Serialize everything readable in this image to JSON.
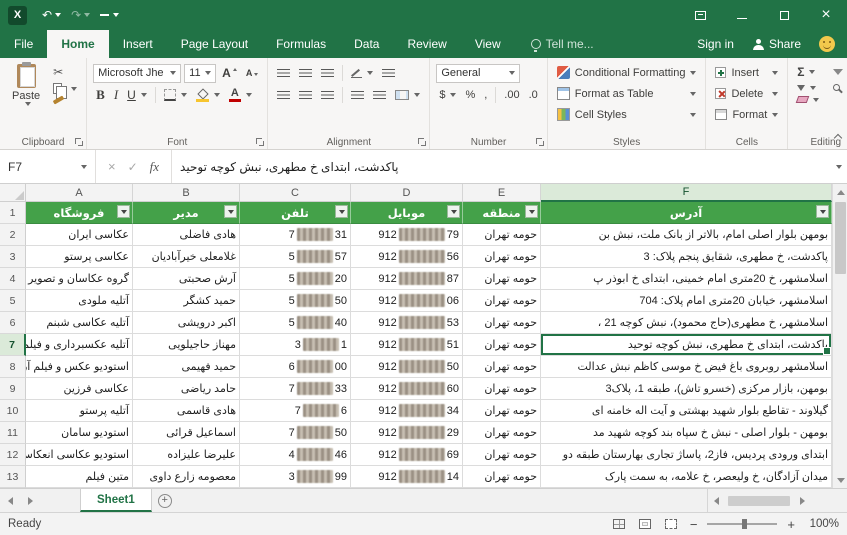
{
  "colors": {
    "accent": "#217346",
    "table_header_green": "#44a149",
    "smiley_yellow": "#f2c94c"
  },
  "icons": {
    "app": "X",
    "undo": "↶",
    "redo": "↷",
    "close": "×",
    "cancel": "×",
    "enter": "✓",
    "scissors": "✂",
    "letter_a": "A",
    "plus": "+",
    "minus": "−",
    "plus_zoom": "+"
  },
  "ribbon_tabs": {
    "file": "File",
    "tabs": [
      "Home",
      "Insert",
      "Page Layout",
      "Formulas",
      "Data",
      "Review",
      "View"
    ],
    "active": "Home",
    "tell_me": "Tell me...",
    "sign_in": "Sign in",
    "share": "Share"
  },
  "ribbon": {
    "clipboard": {
      "label": "Clipboard",
      "paste": "Paste"
    },
    "font": {
      "label": "Font",
      "font_name": "Microsoft Jhe",
      "font_size": "11",
      "bold": "B",
      "italic": "I",
      "underline": "U"
    },
    "alignment": {
      "label": "Alignment"
    },
    "number": {
      "label": "Number",
      "format": "General",
      "currency": "$",
      "percent": "%",
      "comma": ",",
      "increase_decimal": ".00",
      "decrease_decimal": ".0"
    },
    "styles": {
      "label": "Styles",
      "conditional_formatting": "Conditional Formatting",
      "format_as_table": "Format as Table",
      "cell_styles": "Cell Styles"
    },
    "cells": {
      "label": "Cells",
      "insert": "Insert",
      "delete": "Delete",
      "format": "Format"
    },
    "editing": {
      "label": "Editing",
      "autosum": "Σ"
    }
  },
  "formula_bar": {
    "name_box": "F7",
    "fx": "fx",
    "formula": "پاکدشت، ابتدای خ مطهری، نبش کوچه توحید"
  },
  "grid": {
    "columns": [
      "A",
      "B",
      "C",
      "D",
      "E",
      "F"
    ],
    "selected_column": "F",
    "selected_row": 7,
    "selected_cell": "F7",
    "headers": {
      "store": "فروشگاه",
      "manager": "مدیر",
      "phone": "تلفن",
      "mobile": "موبایل",
      "region": "منطقه",
      "address": "آدرس"
    },
    "rows": [
      {
        "n": 2,
        "store": "عکاسی ایران",
        "manager": "هادی فاضلی",
        "phone_start": "7",
        "phone_end": "31",
        "mobile_start": "912",
        "mobile_end": "79",
        "region": "حومه تهران",
        "address": "بومهن بلوار اصلی امام، بالاتر از بانک ملت، نبش بن"
      },
      {
        "n": 3,
        "store": "عکاسی پرستو",
        "manager": "غلامعلی خیرآبادیان",
        "phone_start": "5",
        "phone_end": "57",
        "mobile_start": "912",
        "mobile_end": "56",
        "region": "حومه تهران",
        "address": "پاکدشت، خ مطهری، شقایق پنجم پلاک: 3"
      },
      {
        "n": 4,
        "store": "گروه عکاسان و تصویر",
        "manager": "آرش صحبتی",
        "phone_start": "5",
        "phone_end": "20",
        "mobile_start": "912",
        "mobile_end": "87",
        "region": "حومه تهران",
        "address": "اسلامشهر، خ 20متری امام خمینی، ابتدای خ ابوذر پ"
      },
      {
        "n": 5,
        "store": "آتلیه ملودی",
        "manager": "حمید کشگر",
        "phone_start": "5",
        "phone_end": "50",
        "mobile_start": "912",
        "mobile_end": "06",
        "region": "حومه تهران",
        "address": "اسلامشهر، خیابان 20متری امام پلاک: 704"
      },
      {
        "n": 6,
        "store": "آتلیه عکاسی شبنم",
        "manager": "اکبر درویشی",
        "phone_start": "5",
        "phone_end": "40",
        "mobile_start": "912",
        "mobile_end": "53",
        "region": "حومه تهران",
        "address": "اسلامشهر، خ مطهری(حاج محمود)، نبش کوچه 21 ،"
      },
      {
        "n": 7,
        "store": "آتلیه عکسبرداری و فیلم",
        "manager": "مهناز حاجیلویی",
        "phone_start": "3",
        "phone_end": "1",
        "mobile_start": "912",
        "mobile_end": "51",
        "region": "حومه تهران",
        "address": "پاکدشت، ابتدای خ مطهری، نبش کوچه توحید"
      },
      {
        "n": 8,
        "store": "استودیو عکس و فیلم آر",
        "manager": "حمید فهیمی",
        "phone_start": "6",
        "phone_end": "00",
        "mobile_start": "912",
        "mobile_end": "50",
        "region": "حومه تهران",
        "address": "اسلامشهر روبروی باغ فیض خ موسی کاظم نبش عدالت"
      },
      {
        "n": 9,
        "store": "عکاسی فرزین",
        "manager": "حامد ریاضی",
        "phone_start": "7",
        "phone_end": "33",
        "mobile_start": "912",
        "mobile_end": "60",
        "region": "حومه تهران",
        "address": "بومهن، بازار مرکزی (خسرو تاش)، طبقه 1، پلاک3"
      },
      {
        "n": 10,
        "store": "آتلیه پرستو",
        "manager": "هادی قاسمی",
        "phone_start": "7",
        "phone_end": "6",
        "mobile_start": "912",
        "mobile_end": "34",
        "region": "حومه تهران",
        "address": "گیلاوند - تقاطع بلوار شهید بهشتی و آیت اله خامنه ای"
      },
      {
        "n": 11,
        "store": "استودیو سامان",
        "manager": "اسماعیل قرائی",
        "phone_start": "7",
        "phone_end": "50",
        "mobile_start": "912",
        "mobile_end": "29",
        "region": "حومه تهران",
        "address": "بومهن - بلوار اصلی - نبش خ سپاه بند کوچه شهید مد"
      },
      {
        "n": 12,
        "store": "استودیو عکاسی انعکاس",
        "manager": "علیرضا علیزاده",
        "phone_start": "4",
        "phone_end": "46",
        "mobile_start": "912",
        "mobile_end": "69",
        "region": "حومه تهران",
        "address": "ابتدای ورودی پردیس، فاز2، پاساژ تجاری بهارستان طبقه دو"
      },
      {
        "n": 13,
        "store": "متین فیلم",
        "manager": "معصومه زارع داوی",
        "phone_start": "3",
        "phone_end": "99",
        "mobile_start": "912",
        "mobile_end": "14",
        "region": "حومه تهران",
        "address": "میدان آزادگان، خ ولیعصر، خ علامه، به سمت پارک"
      }
    ]
  },
  "sheet_tabs": {
    "active": "Sheet1"
  },
  "status_bar": {
    "status": "Ready",
    "zoom": "100%"
  }
}
